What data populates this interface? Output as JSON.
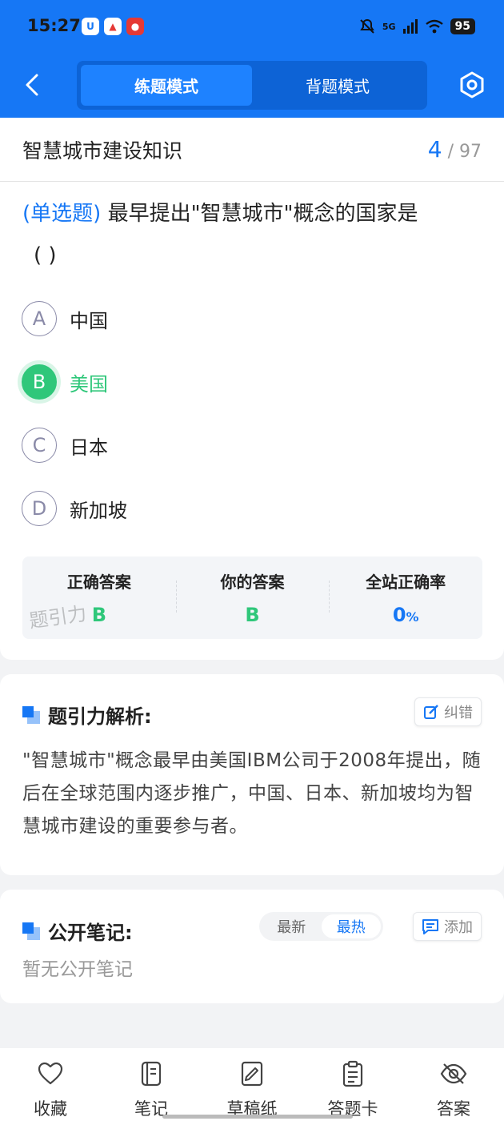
{
  "status_bar": {
    "time": "15:27",
    "network": "5G",
    "battery": "95"
  },
  "header": {
    "modes": [
      {
        "label": "练题模式",
        "active": true
      },
      {
        "label": "背题模式",
        "active": false
      }
    ],
    "back_icon": "chevron-left-icon",
    "settings_icon": "hexagon-settings-icon"
  },
  "subject": {
    "title": "智慧城市建设知识",
    "current": "4",
    "separator": "/",
    "total": "97"
  },
  "question": {
    "type_label": "(单选题)",
    "text": "最早提出\"智慧城市\"概念的国家是",
    "blank": "(        )",
    "options": [
      {
        "letter": "A",
        "text": "中国",
        "selected": false
      },
      {
        "letter": "B",
        "text": "美国",
        "selected": true
      },
      {
        "letter": "C",
        "text": "日本",
        "selected": false
      },
      {
        "letter": "D",
        "text": "新加坡",
        "selected": false
      }
    ]
  },
  "answers": {
    "correct_label": "正确答案",
    "correct_value": "B",
    "yours_label": "你的答案",
    "yours_value": "B",
    "rate_label": "全站正确率",
    "rate_value": "0",
    "rate_unit": "%",
    "watermark": "题引力"
  },
  "analysis": {
    "title": "题引力解析:",
    "correct_button": "纠错",
    "text": "\"智慧城市\"概念最早由美国IBM公司于2008年提出，随后在全球范围内逐步推广，中国、日本、新加坡均为智慧城市建设的重要参与者。"
  },
  "notes": {
    "title": "公开笔记:",
    "sort_options": [
      {
        "label": "最新",
        "active": false
      },
      {
        "label": "最热",
        "active": true
      }
    ],
    "add_button": "添加",
    "empty_text": "暂无公开笔记"
  },
  "bottom_tabs": [
    {
      "label": "收藏",
      "icon": "heart-icon"
    },
    {
      "label": "笔记",
      "icon": "notebook-icon"
    },
    {
      "label": "草稿纸",
      "icon": "draft-paper-icon"
    },
    {
      "label": "答题卡",
      "icon": "answer-card-icon"
    },
    {
      "label": "答案",
      "icon": "eye-slash-icon"
    }
  ],
  "colors": {
    "primary": "#1677f5",
    "correct": "#2fc77a",
    "header_dark": "#0d63d6"
  }
}
